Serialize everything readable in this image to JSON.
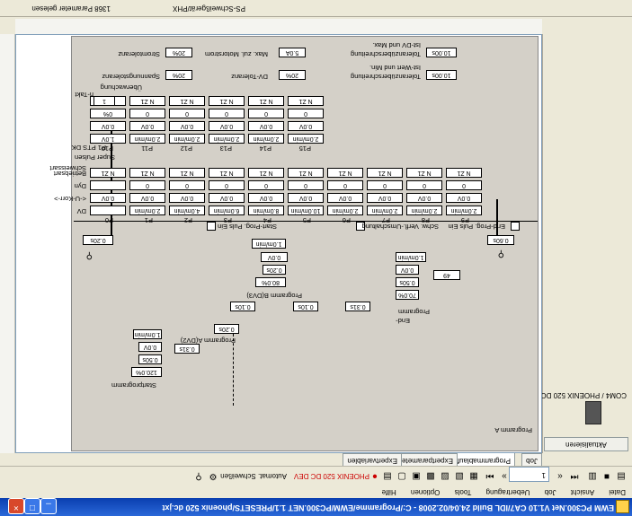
{
  "window": {
    "title": "EWM PC300.Net V1.10 CA7/IDL Build 24.04/02.2008 - C:/Programme/EWM/PC300.NET 1.1/PRESETS/phoenix 520 dc.jxt"
  },
  "menu": [
    "Datei",
    "Ansicht",
    "Job",
    "Uebertragung",
    "Tools",
    "Optionen",
    "Hilfe"
  ],
  "toolbar": {
    "job_number": "1",
    "device": "PHOENIX 520 DC DEV",
    "auto_label": "Automat. Schweißen"
  },
  "tabs": [
    "Job",
    "Programmablauf",
    "Expertparameter",
    "Expertvariablen"
  ],
  "sidebar": {
    "button": "Aktualisieren",
    "device_label": "COM4 / PHOENIX 520 DC"
  },
  "panel": {
    "program_a_label": "Programm A",
    "top": {
      "checkbox1": "Start-Prog. Puls Ein",
      "checkbox2": "Schw. Verfl.-Umschaltung",
      "checkbox3": "End-Prog. Puls Ein",
      "p_start_time": "0.20s",
      "p_end_time": "0.60s",
      "prog_b": {
        "t": "80.0%",
        "v": "0.20s",
        "w": "0.0V",
        "label": "Programm B(DV3)",
        "ramp": "1.0m/min"
      },
      "end": {
        "val": "70.0%",
        "time": "0.50s",
        "volt": "0.0V",
        "wire": "1.0m/min",
        "label1": "Programm",
        "label2": "End-",
        "box": "49"
      },
      "slope1": "0.10s",
      "slope2": "0.10s",
      "slope3": "0.31s",
      "prog_a": {
        "t": "0.20s",
        "label": "Programm A(DV2)"
      },
      "start": {
        "val": "120.0%",
        "time": "0.50s",
        "volt": "0.0V",
        "wire": "1.0m/min",
        "label": "Startprogramm",
        "slope": "0.31s"
      }
    },
    "ptable": {
      "row_labels": [
        "DV",
        "<-U-Korr->",
        "Dyn",
        "Betriebsart",
        "Schweissart"
      ],
      "col_heads": [
        "P0",
        "P1",
        "P2",
        "P3",
        "P4",
        "P5",
        "P6",
        "P7",
        "P8",
        "P9"
      ],
      "dv": [
        "",
        "2.0m/min",
        "4.0m/min",
        "6.0m/min",
        "8.0m/min",
        "10.0m/min",
        "2.0m/min",
        "2.0m/min",
        "2.0m/min",
        "2.0m/min"
      ],
      "ukorr": [
        "0.0V",
        "0.0V",
        "0.0V",
        "0.0V",
        "0.0V",
        "0.0V",
        "0.0V",
        "0.0V",
        "0.0V",
        "0.0V"
      ],
      "dyn": [
        "",
        "0",
        "0",
        "0",
        "0",
        "0",
        "0",
        "0",
        "0",
        "0"
      ],
      "schweissart": [
        "N Z1",
        "N Z1",
        "N Z1",
        "N Z1",
        "N Z1",
        "N Z1",
        "N Z1",
        "N Z1",
        "N Z1",
        "N Z1"
      ]
    },
    "super_pulse": {
      "label1": "Super Pulsen",
      "label2": "P1 PTS DK",
      "col_heads": [
        "P10",
        "P11",
        "P12",
        "P13",
        "P14",
        "P15"
      ],
      "dv": [
        "1.0V",
        "2.0m/min",
        "2.0m/min",
        "2.0m/min",
        "2.0m/min",
        "2.0m/min"
      ],
      "ukorr": [
        "0.0V",
        "0.0V",
        "0.0V",
        "0.0V",
        "0.0V",
        "0.0V"
      ],
      "dyn": [
        "0%",
        "0",
        "0",
        "0",
        "0",
        "0"
      ],
      "art": [
        "",
        "N Z1",
        "N Z1",
        "N Z1",
        "N Z1",
        "N Z1"
      ],
      "ntakt_label": "n-Takt",
      "ntakt": "1"
    },
    "monitor": {
      "label": "Überwachung",
      "sp_label": "Spannungstoleranz",
      "sp": "20%",
      "dv_label": "DV-Toleranz",
      "dv": "20%",
      "tol_label": "Toleranzüberschreitung",
      "tol": "10.00s",
      "strom_label": "Stromtoleranz",
      "strom": "20%",
      "maxmot_label": "Max. zul. Motorstrom",
      "maxmot": "5.0A",
      "tol2_label": "Toleranzüberschreitung",
      "tol2": "10.00s",
      "ist_label": "Ist-Wert und Min.",
      "ist2_label": "Ist-DV und Max."
    }
  },
  "status": {
    "left": "1368 Parameter gelesen",
    "right": "PS-Schweißgerät/PHX"
  },
  "colors": {
    "titlebar": "#0a3fb0",
    "panel_bg": "#d4d0c8",
    "window_bg": "#ece9d8"
  }
}
